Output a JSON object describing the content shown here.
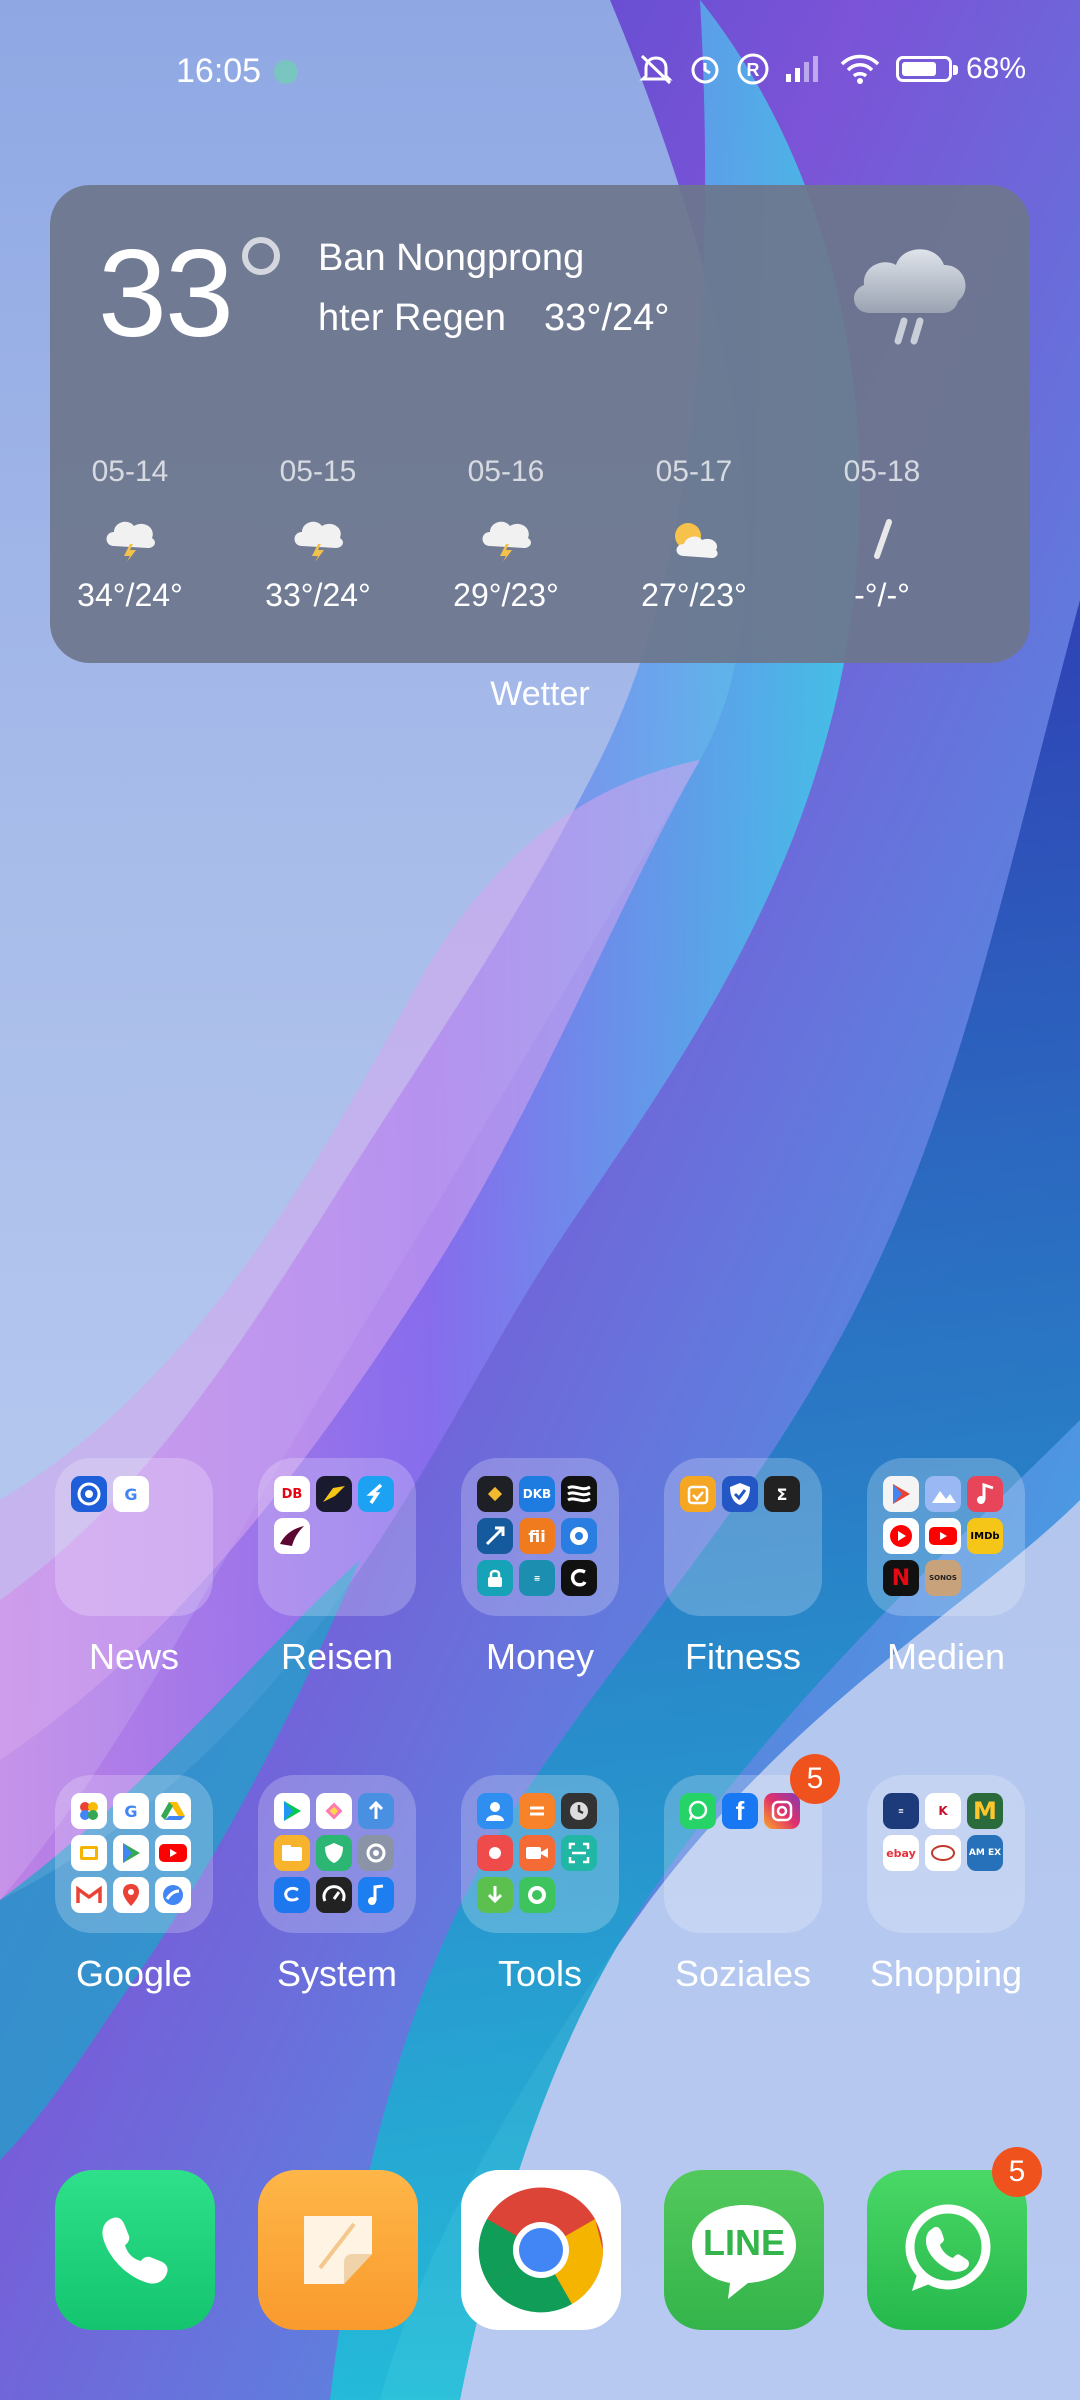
{
  "status_bar": {
    "time": "16:05",
    "battery": "68%",
    "icons": [
      "whatsapp-notification-icon",
      "mute-icon",
      "alarm-icon",
      "roaming-icon",
      "signal-icon",
      "wifi-icon",
      "battery-icon"
    ]
  },
  "weather": {
    "temperature": "33",
    "city": "Ban Nongprong",
    "condition": "hter Regen",
    "range": "33°/24°",
    "forecast": [
      {
        "date": "05-14",
        "temp": "34°/24°",
        "icon": "thunder-icon"
      },
      {
        "date": "05-15",
        "temp": "33°/24°",
        "icon": "thunder-icon"
      },
      {
        "date": "05-16",
        "temp": "29°/23°",
        "icon": "thunder-icon"
      },
      {
        "date": "05-17",
        "temp": "27°/23°",
        "icon": "partly-cloudy-icon"
      },
      {
        "date": "05-18",
        "temp": "-°/-°",
        "icon": "no-data"
      }
    ],
    "widget_label": "Wetter"
  },
  "folders_row1": [
    {
      "label": "News"
    },
    {
      "label": "Reisen"
    },
    {
      "label": "Money"
    },
    {
      "label": "Fitness"
    },
    {
      "label": "Medien"
    }
  ],
  "folders_row2": [
    {
      "label": "Google"
    },
    {
      "label": "System"
    },
    {
      "label": "Tools"
    },
    {
      "label": "Soziales",
      "badge": "5"
    },
    {
      "label": "Shopping"
    }
  ],
  "mini_text": {
    "db": "DB",
    "dkb": "DKB",
    "sigma": "Σ",
    "imdb": "IMDb",
    "sonos": "SONOS",
    "g": "G",
    "amex": "AM EX",
    "ebay": "ebay",
    "line": "LINE"
  },
  "dock": [
    {
      "name": "phone"
    },
    {
      "name": "notes"
    },
    {
      "name": "chrome"
    },
    {
      "name": "line",
      "label": "LINE"
    },
    {
      "name": "whatsapp",
      "badge": "5"
    }
  ],
  "colors": {
    "badge": "#f0521e",
    "widget_bg": "#6c768c"
  }
}
